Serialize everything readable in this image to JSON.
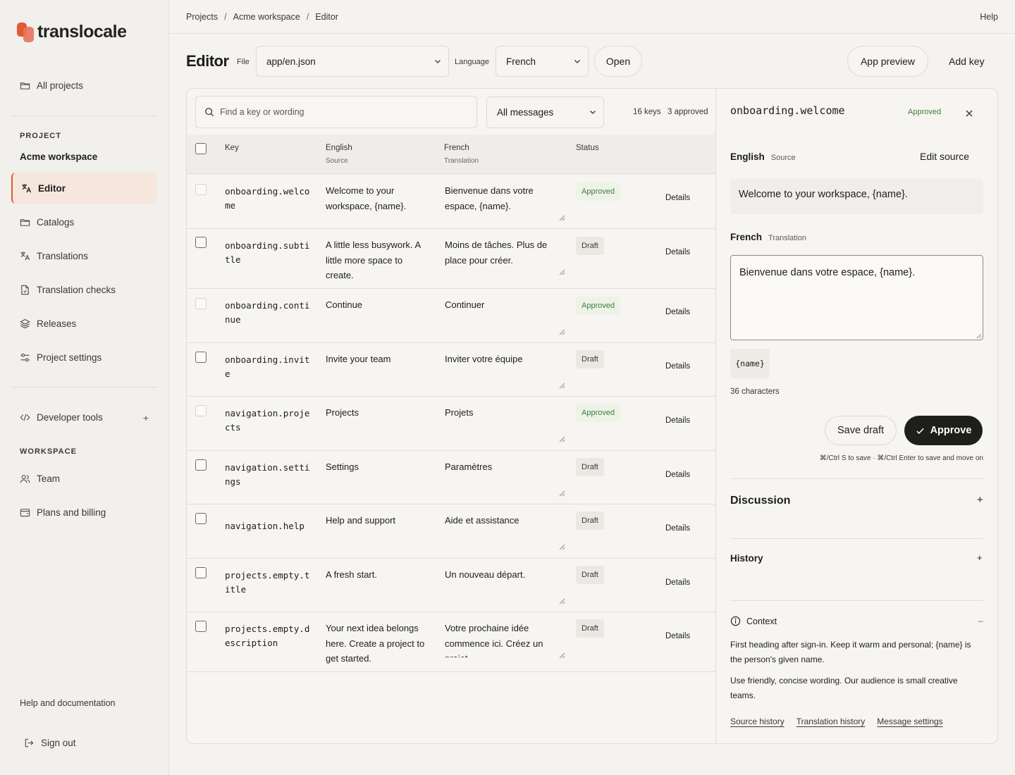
{
  "app": {
    "brand": "translocale",
    "accent": "#e05a33"
  },
  "sidebar": {
    "all_projects": "All projects",
    "project_label": "PROJECT",
    "workspace_name": "Acme workspace",
    "items": [
      {
        "label": "Editor",
        "icon": "translate-icon",
        "active": true
      },
      {
        "label": "Catalogs",
        "icon": "folder-icon"
      },
      {
        "label": "Translations",
        "icon": "translate-icon"
      },
      {
        "label": "Translation checks",
        "icon": "document-icon"
      },
      {
        "label": "Releases",
        "icon": "layers-icon"
      },
      {
        "label": "Project settings",
        "icon": "sliders-icon"
      }
    ],
    "developer_tools": "Developer tools",
    "workspace_label": "WORKSPACE",
    "team": "Team",
    "plans": "Plans and billing",
    "help_docs": "Help and documentation",
    "sign_out": "Sign out"
  },
  "topbar": {
    "breadcrumb": [
      "Projects",
      "Acme workspace",
      "Editor"
    ],
    "help": "Help"
  },
  "editor": {
    "title": "Editor",
    "file_label": "File",
    "file_value": "app/en.json",
    "language_label": "Language",
    "language_value": "French",
    "open": "Open",
    "app_preview": "App preview",
    "add_key": "Add key"
  },
  "list": {
    "search_placeholder": "Find a key or wording",
    "filter_value": "All messages",
    "keys_count": "16 keys",
    "approved_count": "3 approved",
    "headers": {
      "key": "Key",
      "english": "English",
      "english_sub": "Source",
      "french": "French",
      "french_sub": "Translation",
      "status": "Status"
    },
    "details_label": "Details",
    "rows": [
      {
        "key": "onboarding.welcome",
        "source": "Welcome to your workspace, {name}.",
        "translation": "Bienvenue dans votre espace, {name}.",
        "status": "Approved"
      },
      {
        "key": "onboarding.subtitle",
        "source": "A little less busywork. A little more space to create.",
        "translation": "Moins de tâches. Plus de place pour créer.",
        "status": "Draft"
      },
      {
        "key": "onboarding.continue",
        "source": "Continue",
        "translation": "Continuer",
        "status": "Approved"
      },
      {
        "key": "onboarding.invite",
        "source": "Invite your team",
        "translation": "Inviter votre équipe",
        "status": "Draft"
      },
      {
        "key": "navigation.projects",
        "source": "Projects",
        "translation": "Projets",
        "status": "Approved"
      },
      {
        "key": "navigation.settings",
        "source": "Settings",
        "translation": "Paramètres",
        "status": "Draft"
      },
      {
        "key": "navigation.help",
        "source": "Help and support",
        "translation": "Aide et assistance",
        "status": "Draft"
      },
      {
        "key": "projects.empty.title",
        "source": "A fresh start.",
        "translation": "Un nouveau départ.",
        "status": "Draft"
      },
      {
        "key": "projects.empty.description",
        "source": "Your next idea belongs here. Create a project to get started.",
        "translation": "Votre prochaine idée commence ici. Créez un projet",
        "status": "Draft"
      }
    ]
  },
  "panel": {
    "key": "onboarding.welcome",
    "status": "Approved",
    "english": "English",
    "english_sub": "Source",
    "edit_source": "Edit source",
    "source_text": "Welcome to your workspace, {name}.",
    "french": "French",
    "french_sub": "Translation",
    "translation_text": "Bienvenue dans votre espace, {name}.",
    "placeholder_token": "{name}",
    "char_count": "36 characters",
    "save_draft": "Save draft",
    "approve": "Approve",
    "hint": "⌘/Ctrl S to save · ⌘/Ctrl Enter to save and move on",
    "discussion": "Discussion",
    "history": "History",
    "context": "Context",
    "context_p1": "First heading after sign-in. Keep it warm and personal; {name} is the person's given name.",
    "context_p2": "Use friendly, concise wording. Our audience is small creative teams.",
    "links": [
      "Source history",
      "Translation history",
      "Message settings"
    ]
  }
}
